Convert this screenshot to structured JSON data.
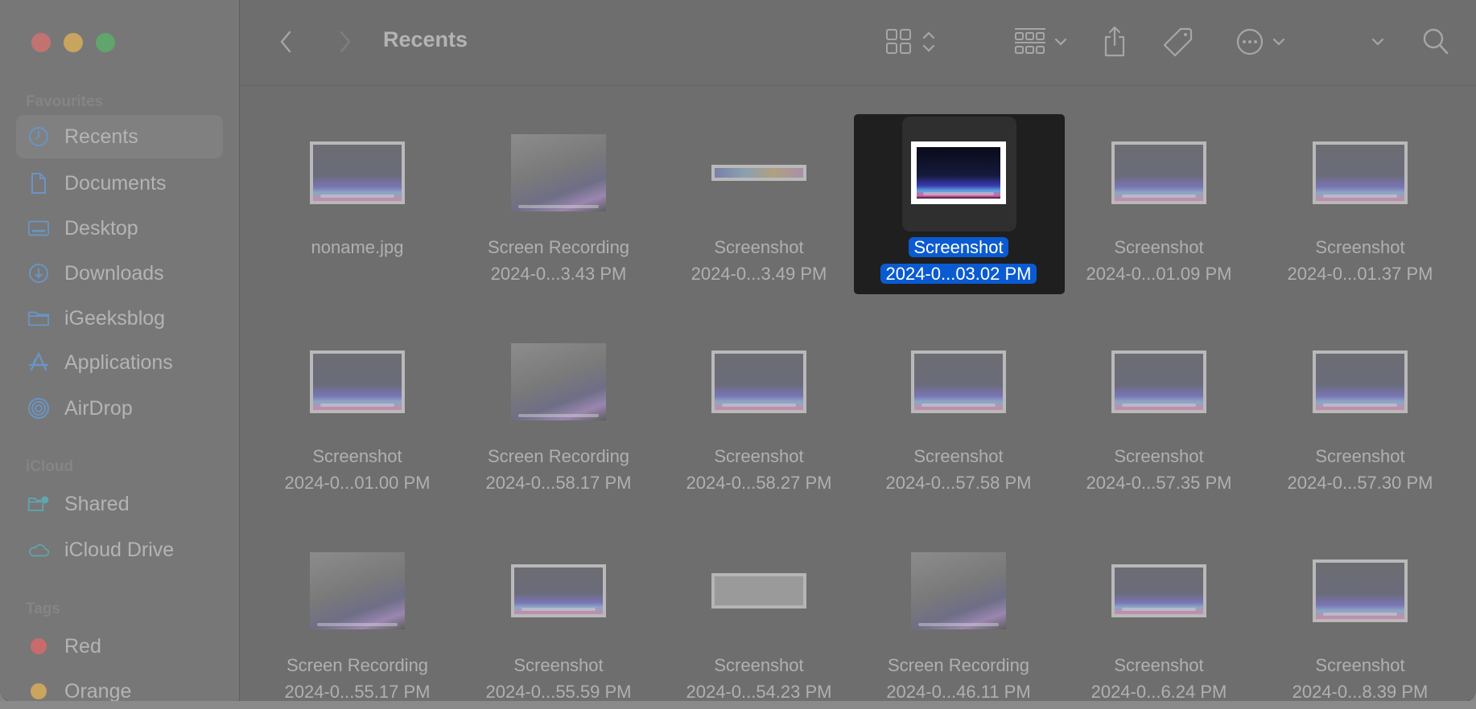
{
  "window": {
    "title": "Recents",
    "traffic_lights": {
      "close": "#c37272",
      "minimize": "#c8a45f",
      "zoom": "#5fa56c"
    }
  },
  "toolbar": {
    "back_icon": "chevron-left-icon",
    "forward_icon": "chevron-right-icon",
    "title": "Recents",
    "buttons": [
      {
        "name": "view-icon-grid",
        "icon": "grid-icon"
      },
      {
        "name": "group-by",
        "icon": "group-icon"
      },
      {
        "name": "share",
        "icon": "share-icon"
      },
      {
        "name": "tags",
        "icon": "tag-icon"
      },
      {
        "name": "more-actions",
        "icon": "ellipsis-circle-icon"
      },
      {
        "name": "expand",
        "icon": "chevron-down-icon"
      },
      {
        "name": "search",
        "icon": "search-icon"
      }
    ]
  },
  "sidebar": {
    "sections": [
      {
        "header": "Favourites",
        "items": [
          {
            "label": "Recents",
            "icon": "clock-icon",
            "selected": true
          },
          {
            "label": "Documents",
            "icon": "document-icon"
          },
          {
            "label": "Desktop",
            "icon": "desktop-icon"
          },
          {
            "label": "Downloads",
            "icon": "download-icon"
          },
          {
            "label": "iGeeksblog",
            "icon": "folder-icon"
          },
          {
            "label": "Applications",
            "icon": "applications-icon"
          },
          {
            "label": "AirDrop",
            "icon": "airdrop-icon"
          }
        ]
      },
      {
        "header": "iCloud",
        "items": [
          {
            "label": "Shared",
            "icon": "shared-folder-icon"
          },
          {
            "label": "iCloud Drive",
            "icon": "cloud-icon"
          }
        ]
      },
      {
        "header": "Tags",
        "items": [
          {
            "label": "Red",
            "color": "#c96b6b"
          },
          {
            "label": "Orange",
            "color": "#c9a55e"
          }
        ]
      }
    ]
  },
  "accent_color": "#0a5bd1",
  "files": [
    {
      "line1": "noname.jpg",
      "line2": ""
    },
    {
      "line1": "Screen Recording",
      "line2": "2024-0...3.43 PM"
    },
    {
      "line1": "Screenshot",
      "line2": "2024-0...3.49 PM"
    },
    {
      "line1": "Screenshot",
      "line2": "2024-0...03.02 PM",
      "selected": true
    },
    {
      "line1": "Screenshot",
      "line2": "2024-0...01.09 PM"
    },
    {
      "line1": "Screenshot",
      "line2": "2024-0...01.37 PM"
    },
    {
      "line1": "Screenshot",
      "line2": "2024-0...01.00 PM"
    },
    {
      "line1": "Screen Recording",
      "line2": "2024-0...58.17 PM"
    },
    {
      "line1": "Screenshot",
      "line2": "2024-0...58.27 PM"
    },
    {
      "line1": "Screenshot",
      "line2": "2024-0...57.58 PM"
    },
    {
      "line1": "Screenshot",
      "line2": "2024-0...57.35 PM"
    },
    {
      "line1": "Screenshot",
      "line2": "2024-0...57.30 PM"
    },
    {
      "line1": "Screen Recording",
      "line2": "2024-0...55.17 PM"
    },
    {
      "line1": "Screenshot",
      "line2": "2024-0...55.59 PM"
    },
    {
      "line1": "Screenshot",
      "line2": "2024-0...54.23 PM"
    },
    {
      "line1": "Screen Recording",
      "line2": "2024-0...46.11 PM"
    },
    {
      "line1": "Screenshot",
      "line2": "2024-0...6.24 PM"
    },
    {
      "line1": "Screenshot",
      "line2": "2024-0...8.39 PM"
    }
  ]
}
